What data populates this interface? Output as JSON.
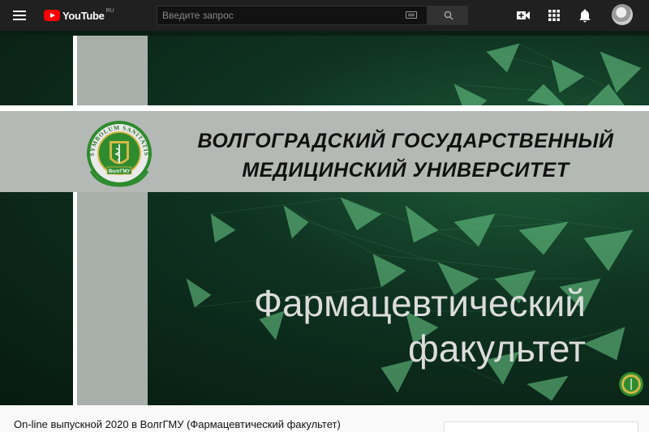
{
  "topbar": {
    "logo_text": "YouTube",
    "logo_region": "RU",
    "search_placeholder": "Введите запрос",
    "icons": [
      "menu-icon",
      "youtube-logo-icon",
      "keyboard-icon",
      "search-icon",
      "create-video-icon",
      "apps-grid-icon",
      "notifications-bell-icon",
      "avatar"
    ]
  },
  "video": {
    "university_line1": "ВОЛГОГРАДСКИЙ ГОСУДАРСТВЕННЫЙ",
    "university_line2": "МЕДИЦИНСКИЙ УНИВЕРСИТЕТ",
    "emblem_text_top": "SYMBOLUM SANITATIS",
    "emblem_text_bottom": "ВолгГМУ",
    "faculty_line1": "Фармацевтический",
    "faculty_line2": "факультет"
  },
  "below_video": {
    "title": "On-line выпускной 2020 в ВолгГМУ (Фармацевтический факультет)"
  },
  "colors": {
    "topbar": "#202020",
    "youtube_red": "#ff0000",
    "video_green": "#0f3321",
    "band_gray": "#b4b9b6",
    "emblem_green": "#2e8b2e",
    "emblem_gold": "#d4b84a"
  }
}
